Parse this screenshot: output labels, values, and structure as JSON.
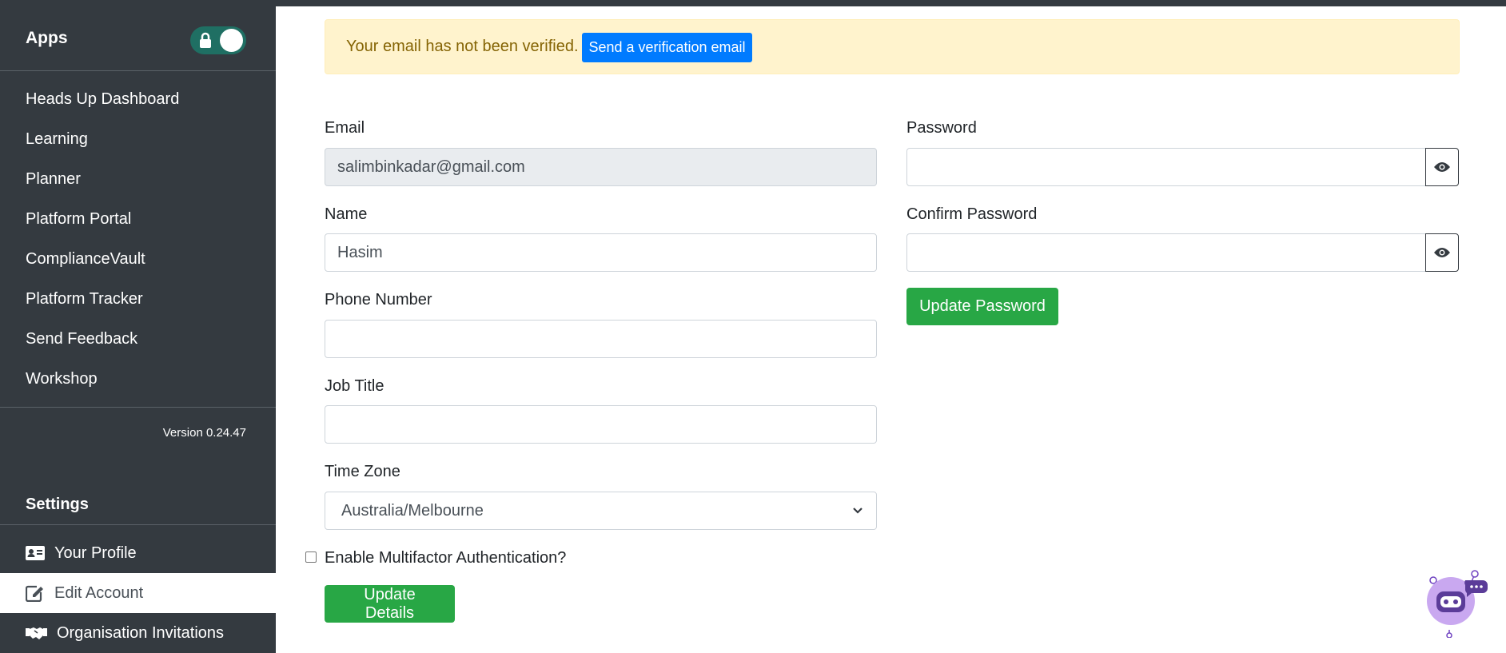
{
  "sidebar": {
    "apps_label": "Apps",
    "nav_items": [
      {
        "label": "Heads Up Dashboard"
      },
      {
        "label": "Learning"
      },
      {
        "label": "Planner"
      },
      {
        "label": "Platform Portal"
      },
      {
        "label": "ComplianceVault"
      },
      {
        "label": "Platform Tracker"
      },
      {
        "label": "Send Feedback"
      },
      {
        "label": "Workshop"
      }
    ],
    "version": "Version 0.24.47",
    "settings_label": "Settings",
    "settings_items": [
      {
        "label": "Your Profile",
        "icon": "id-card-icon"
      },
      {
        "label": "Edit Account",
        "icon": "edit-icon",
        "active": true
      },
      {
        "label": "Organisation Invitations",
        "icon": "handshake-icon"
      }
    ]
  },
  "alert": {
    "message": "Your email has not been verified.",
    "button_label": "Send a verification email"
  },
  "form": {
    "email_label": "Email",
    "email_value": "salimbinkadar@gmail.com",
    "name_label": "Name",
    "name_value": "Hasim",
    "phone_label": "Phone Number",
    "phone_value": "",
    "job_title_label": "Job Title",
    "job_title_value": "",
    "timezone_label": "Time Zone",
    "timezone_value": "Australia/Melbourne",
    "mfa_label": "Enable Multifactor Authentication?",
    "update_details_label": "Update Details",
    "password_label": "Password",
    "confirm_password_label": "Confirm Password",
    "update_password_label": "Update Password"
  },
  "colors": {
    "sidebar_bg": "#343a40",
    "alert_bg": "#fff3cd",
    "primary": "#007bff",
    "success": "#28a745",
    "toggle": "#1f6f63"
  }
}
